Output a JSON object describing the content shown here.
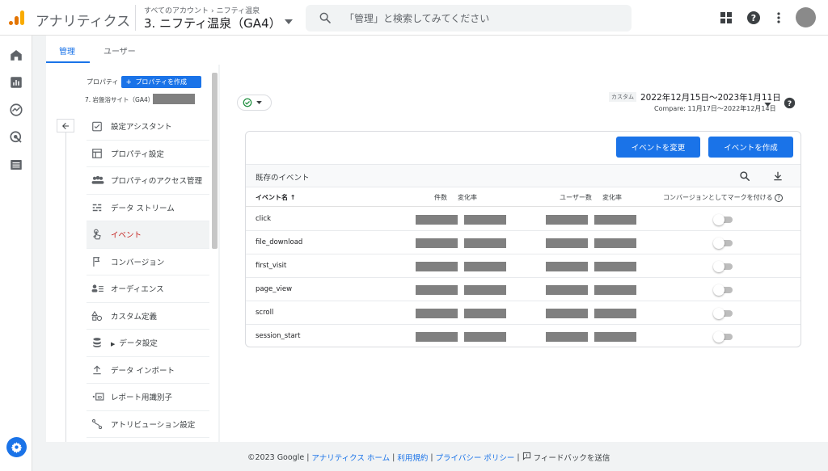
{
  "header": {
    "app_title": "アナリティクス",
    "breadcrumb": {
      "root": "すべてのアカウント",
      "account": "ニフティ温泉"
    },
    "property_name": "3. ニフティ温泉（GA4）",
    "search_placeholder": "「管理」と検索してみてください",
    "icons": [
      "apps-grid-icon",
      "help-icon",
      "more-vert-icon"
    ]
  },
  "rail": {
    "icons": [
      "home-icon",
      "reports-icon",
      "explore-icon",
      "advertising-icon",
      "list-icon",
      "settings-icon"
    ]
  },
  "tabs": [
    {
      "label": "管理",
      "active": true
    },
    {
      "label": "ユーザー",
      "active": false
    }
  ],
  "admin": {
    "property_label": "プロパティ",
    "create_property_label": "プロパティを作成",
    "selected_property": "7. 岩盤浴サイト（GA4）",
    "nav_items": [
      {
        "label": "設定アシスタント",
        "icon": "checklist-icon",
        "active": false
      },
      {
        "label": "プロパティ設定",
        "icon": "property-settings-icon",
        "active": false
      },
      {
        "label": "プロパティのアクセス管理",
        "icon": "people-icon",
        "active": false
      },
      {
        "label": "データ ストリーム",
        "icon": "data-stream-icon",
        "active": false
      },
      {
        "label": "イベント",
        "icon": "touch-icon",
        "active": true
      },
      {
        "label": "コンバージョン",
        "icon": "flag-icon",
        "active": false
      },
      {
        "label": "オーディエンス",
        "icon": "audience-icon",
        "active": false
      },
      {
        "label": "カスタム定義",
        "icon": "shapes-icon",
        "active": false
      },
      {
        "label": "データ設定",
        "icon": "database-icon",
        "active": false,
        "expandable": true
      },
      {
        "label": "データ インポート",
        "icon": "upload-icon",
        "active": false
      },
      {
        "label": "レポート用識別子",
        "icon": "id-icon",
        "active": false
      },
      {
        "label": "アトリビューション設定",
        "icon": "attribution-icon",
        "active": false
      }
    ]
  },
  "main": {
    "date_tag": "カスタム",
    "date_range": "2022年12月15日〜2023年1月11日",
    "compare": "Compare: 11月17日〜2022年12月14日",
    "buttons": {
      "modify_event": "イベントを変更",
      "create_event": "イベントを作成"
    },
    "table_title": "既存のイベント",
    "columns": {
      "event_name": "イベント名",
      "count": "件数",
      "change1": "変化率",
      "users": "ユーザー数",
      "change2": "変化率",
      "conversion": "コンバージョンとしてマークを付ける"
    },
    "rows": [
      {
        "name": "click",
        "conversion": false
      },
      {
        "name": "file_download",
        "conversion": false
      },
      {
        "name": "first_visit",
        "conversion": false
      },
      {
        "name": "page_view",
        "conversion": false
      },
      {
        "name": "scroll",
        "conversion": false
      },
      {
        "name": "session_start",
        "conversion": false
      }
    ]
  },
  "footer": {
    "copyright": "©2023 Google",
    "links": [
      "アナリティクス ホーム",
      "利用規約",
      "プライバシー ポリシー"
    ],
    "feedback": "フィードバックを送信"
  },
  "colors": {
    "accent": "#1a73e8",
    "active_nav": "#c5221f",
    "logo_orange": "#f9ab00",
    "logo_dark": "#e37400",
    "success": "#1e8e3e"
  }
}
